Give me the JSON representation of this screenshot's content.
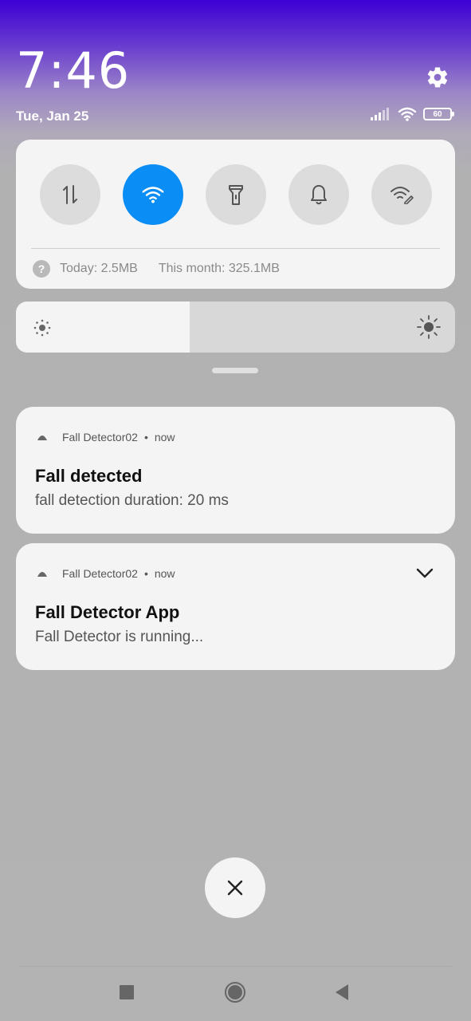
{
  "status": {
    "time": "7:46",
    "date": "Tue, Jan 25",
    "battery_level": "60",
    "signal_icon": "signal-bars-icon",
    "wifi_icon": "wifi-icon",
    "settings_icon": "gear-icon"
  },
  "quick_settings": {
    "toggles": [
      {
        "name": "mobile-data",
        "icon": "data-arrows-icon",
        "active": false
      },
      {
        "name": "wifi",
        "icon": "wifi-icon",
        "active": true
      },
      {
        "name": "flashlight",
        "icon": "flashlight-icon",
        "active": false
      },
      {
        "name": "sound",
        "icon": "bell-icon",
        "active": false
      },
      {
        "name": "hotspot",
        "icon": "wifi-edit-icon",
        "active": false
      }
    ],
    "data_today": "Today: 2.5MB",
    "data_month": "This month: 325.1MB",
    "help_symbol": "?",
    "active_color": "#0a8ef5"
  },
  "brightness": {
    "level": 0.395,
    "low_icon": "brightness-low-icon",
    "high_icon": "brightness-high-icon"
  },
  "notifications": [
    {
      "app": "Fall Detector02",
      "separator": "•",
      "time": "now",
      "title": "Fall detected",
      "body": "fall detection duration: 20 ms"
    },
    {
      "app": "Fall Detector02",
      "separator": "•",
      "time": "now",
      "title": "Fall Detector App",
      "body": "Fall Detector is running..."
    }
  ],
  "clear_all_symbol": "×",
  "nav": {
    "recents_icon": "square-icon",
    "home_icon": "circle-icon",
    "back_icon": "triangle-back-icon"
  }
}
